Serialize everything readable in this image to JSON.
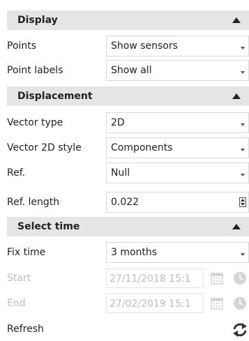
{
  "display": {
    "title": "Display",
    "points": {
      "label": "Points",
      "value": "Show sensors"
    },
    "point_labels": {
      "label": "Point labels",
      "value": "Show all"
    }
  },
  "displacement": {
    "title": "Displacement",
    "vector_type": {
      "label": "Vector type",
      "value": "2D"
    },
    "vector_2d_style": {
      "label": "Vector 2D style",
      "value": "Components"
    },
    "ref": {
      "label": "Ref.",
      "value": "Null"
    },
    "ref_length": {
      "label": "Ref. length",
      "value": "0.022"
    }
  },
  "select_time": {
    "title": "Select time",
    "fix_time": {
      "label": "Fix time",
      "value": "3 months"
    },
    "start": {
      "label": "Start",
      "value": "27/11/2018 15:1"
    },
    "end": {
      "label": "End",
      "value": "27/02/2019 15:1"
    },
    "refresh": {
      "label": "Refresh"
    }
  },
  "icons": {
    "collapse": "triangle-up-icon",
    "dropdown": "chevron-down-icon",
    "calendar": "calendar-icon",
    "clock": "clock-icon",
    "refresh": "refresh-icon"
  },
  "colors": {
    "header_bg": "#e5e5e5",
    "disabled_text": "#bdbdbd",
    "border": "#d9d9d9"
  }
}
